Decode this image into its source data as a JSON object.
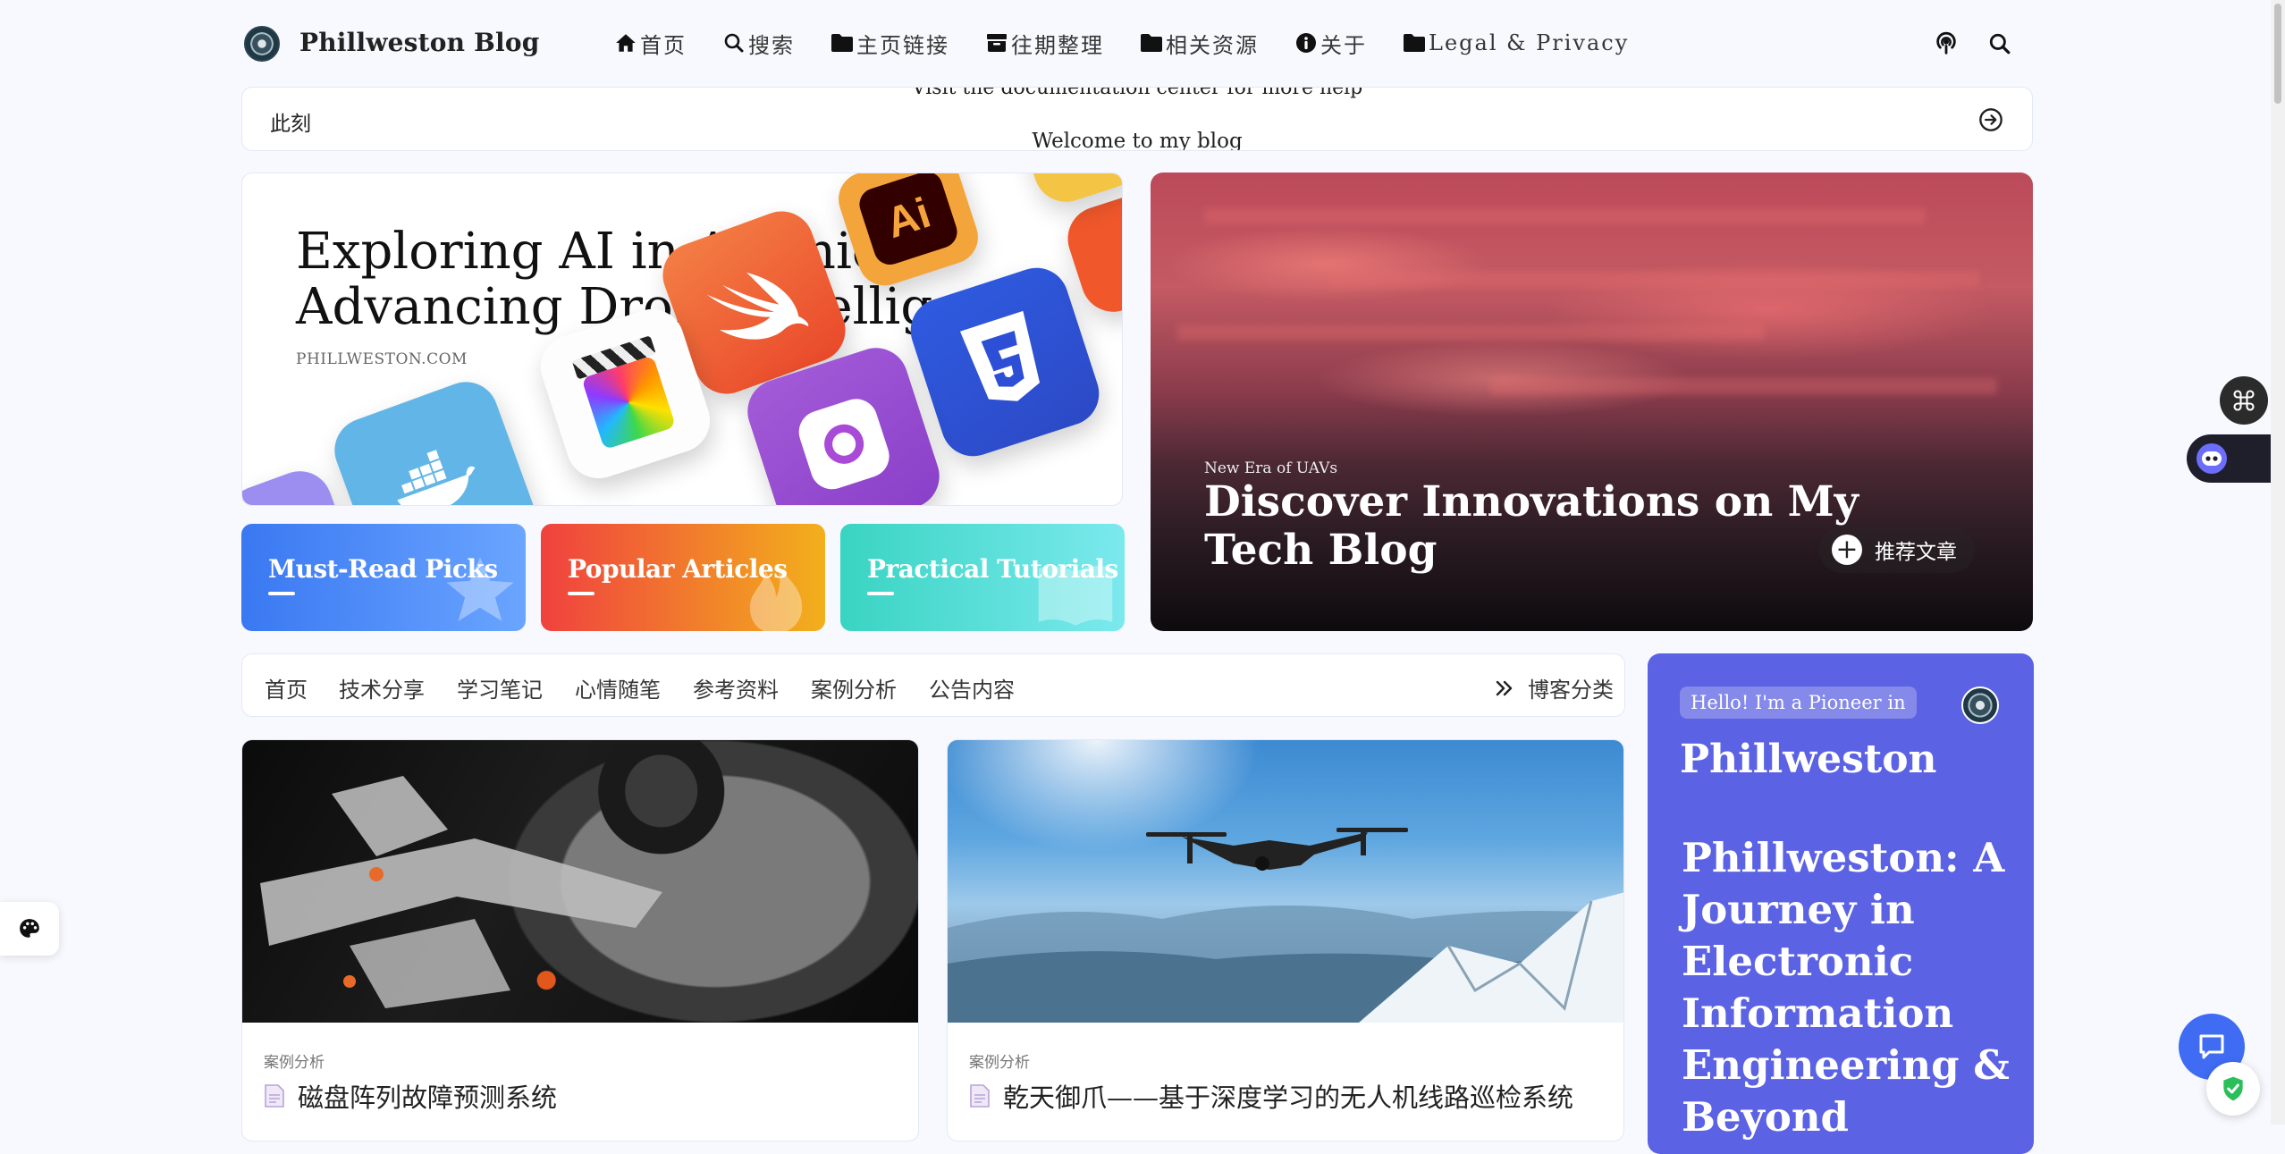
{
  "navbar": {
    "site_name": "Phillweston Blog",
    "menu": [
      {
        "icon": "home-icon",
        "label": "首页"
      },
      {
        "icon": "search-icon",
        "label": "搜索"
      },
      {
        "icon": "folder-icon",
        "label": "主页链接"
      },
      {
        "icon": "archive-icon",
        "label": "往期整理"
      },
      {
        "icon": "folder-icon",
        "label": "相关资源"
      },
      {
        "icon": "info-icon",
        "label": "关于"
      },
      {
        "icon": "folder-icon",
        "label": "Legal & Privacy"
      }
    ],
    "right_icons": [
      "podcast-icon",
      "search-icon"
    ]
  },
  "notice": {
    "label": "此刻",
    "line_prev": "Visit the documentation center for more help",
    "line_current": "Welcome to my blog"
  },
  "hero_left": {
    "title_line1": "Exploring AI in Avionics,",
    "title_line2": "Advancing Drone Intelligence",
    "domain": "PHILLWESTON.COM",
    "icons": [
      "swift-icon",
      "adobe-illustrator-icon",
      "final-cut-pro-icon",
      "css3-icon",
      "docker-icon",
      "pinterest-icon"
    ],
    "ai_icon_text": "Ai"
  },
  "categories": [
    {
      "label": "Must-Read Picks",
      "color_from": "#3a78f2",
      "color_to": "#6aa5ff"
    },
    {
      "label": "Popular Articles",
      "color_from": "#f0413f",
      "color_to": "#f2b01c"
    },
    {
      "label": "Practical Tutorials",
      "color_from": "#39d4c2",
      "color_to": "#7be9ee"
    }
  ],
  "hero_right": {
    "subtitle": "New Era of UAVs",
    "title": "Discover Innovations on My Tech Blog",
    "recommend_label": "推荐文章"
  },
  "tabs": {
    "items": [
      "首页",
      "技术分享",
      "学习笔记",
      "心情随笔",
      "参考资料",
      "案例分析",
      "公告内容"
    ],
    "more_label": "博客分类"
  },
  "posts": [
    {
      "category": "案例分析",
      "title": "磁盘阵列故障预测系统",
      "image": "hard-disk-photo"
    },
    {
      "category": "案例分析",
      "title": "乾天御爪——基于深度学习的无人机线路巡检系统",
      "image": "drone-photo"
    }
  ],
  "author": {
    "badge": "Hello! I'm a Pioneer in",
    "name": "Phillweston",
    "desc": "Phillweston: A Journey in Electronic Information Engineering & Beyond"
  },
  "colors": {
    "accent": "#5b62e3",
    "background": "#f7f9fe",
    "text": "#363636"
  }
}
